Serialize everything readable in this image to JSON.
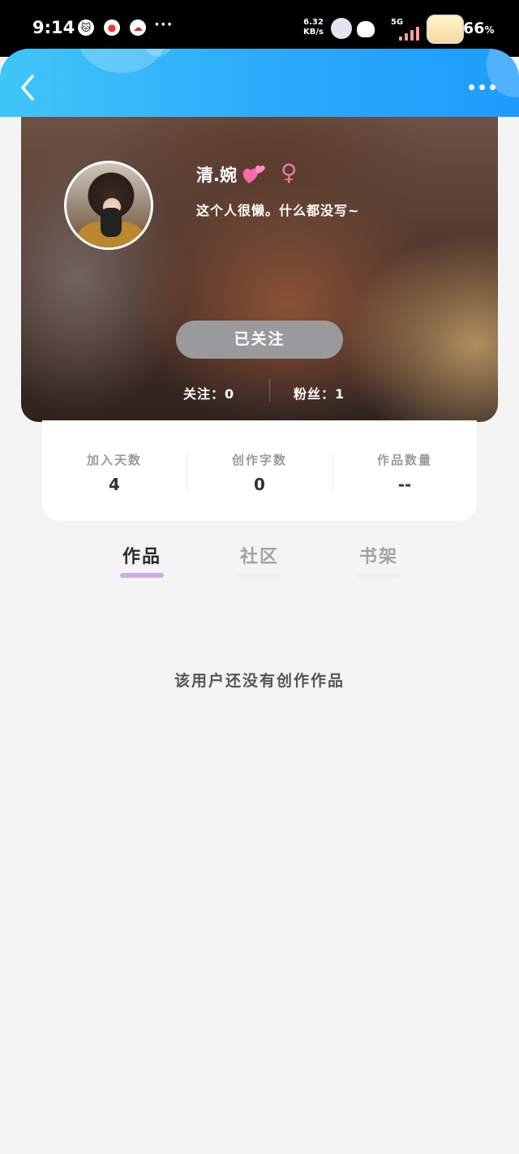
{
  "status_bar": {
    "time": "9:14",
    "net_speed_value": "6.32",
    "net_speed_unit": "KB/s",
    "network": "5G",
    "battery": "66",
    "battery_unit": "%",
    "more": "···"
  },
  "header": {
    "back_icon": "chevron-left-icon",
    "more_icon": "more-horizontal-icon",
    "gradient": [
      "#3fc6f8",
      "#1e9cfd"
    ]
  },
  "profile": {
    "name": "清.婉",
    "gender_symbol": "♀",
    "bio": "这个人很懒。什么都没写~",
    "follow_button": "已关注",
    "following_text": "关注：0",
    "followers_text": "粉丝：1"
  },
  "stats": [
    {
      "label": "加入天数",
      "value": "4"
    },
    {
      "label": "创作字数",
      "value": "0"
    },
    {
      "label": "作品数量",
      "value": "--"
    }
  ],
  "tabs": [
    {
      "label": "作品",
      "active": true
    },
    {
      "label": "社区",
      "active": false
    },
    {
      "label": "书架",
      "active": false
    }
  ],
  "colors": {
    "active_tab_indicator": "#c9aee3",
    "inactive_tab_indicator": "#efefef",
    "gender": "#f07898"
  },
  "empty_message": "该用户还没有创作作品"
}
